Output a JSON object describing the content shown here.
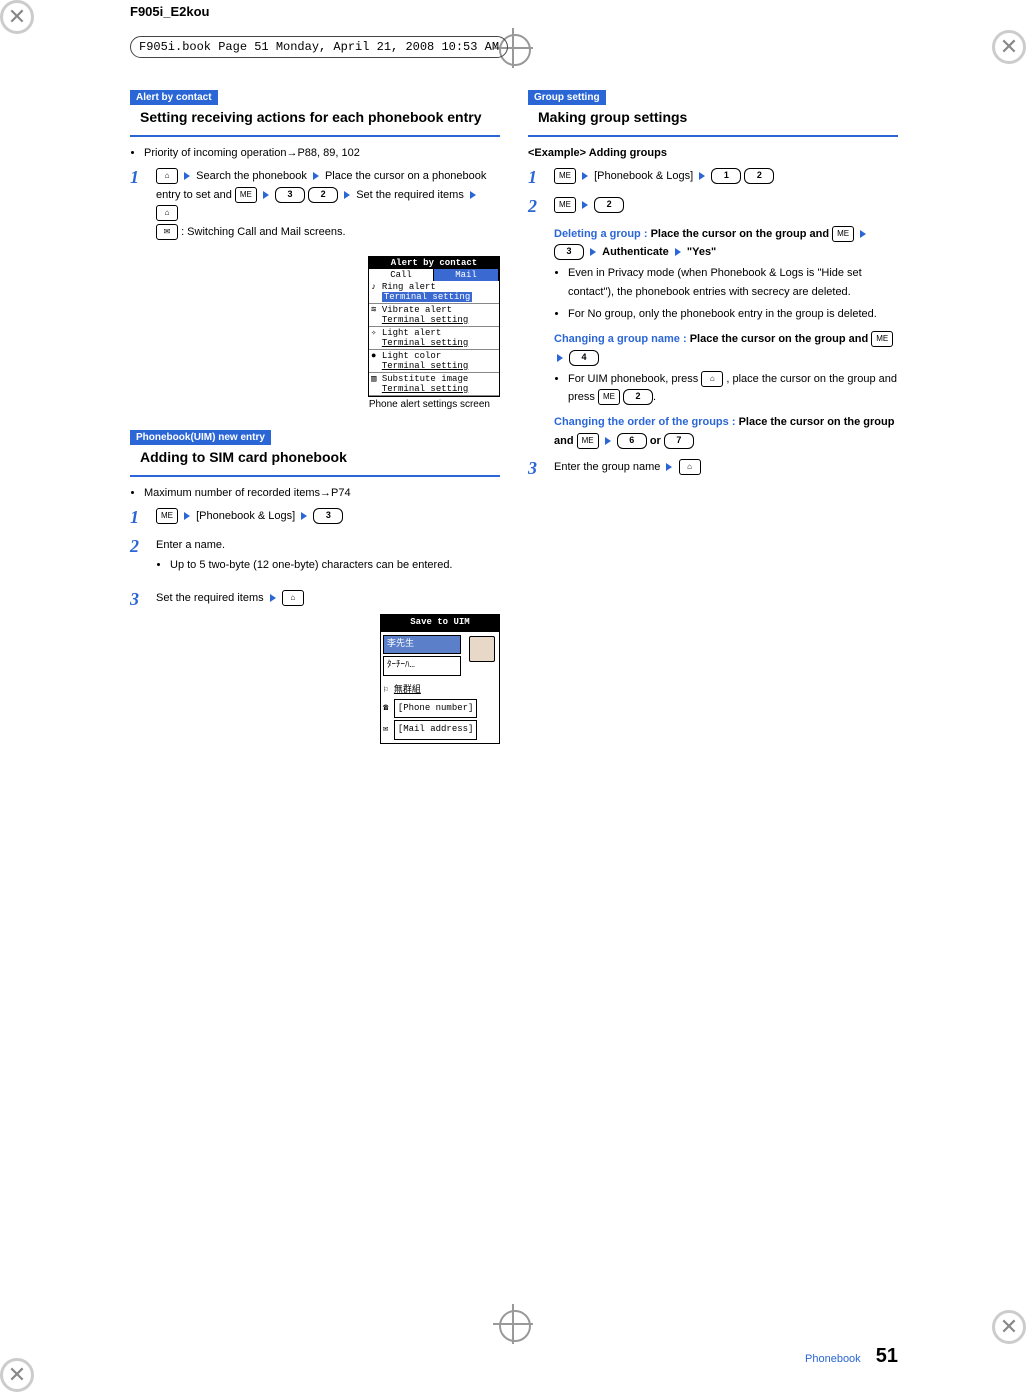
{
  "header": {
    "model": "F905i_E2kou",
    "book_line": "F905i.book  Page 51  Monday, April 21, 2008  10:53 AM"
  },
  "left": {
    "sec1": {
      "tag": "Alert by contact",
      "title": "Setting receiving actions for each phonebook entry"
    },
    "bullet1": "Priority of incoming operation→P88, 89, 102",
    "step1": {
      "pre": "Search the phonebook",
      "mid": "Place the cursor on a phonebook entry to set and",
      "tail": "Set the required items",
      "switch": ": Switching Call and Mail screens."
    },
    "key3": "3",
    "key2": "2",
    "phone_screen": {
      "title": "Alert by contact",
      "tab_call": "Call",
      "tab_mail": "Mail",
      "r1": "Ring alert",
      "v1": "Terminal setting",
      "r2": "Vibrate alert",
      "v2": "Terminal setting",
      "r3": "Light alert",
      "v3": "Terminal setting",
      "r4": "Light color",
      "v4": "Terminal setting",
      "r5": "Substitute image",
      "v5": "Terminal setting"
    },
    "caption": "Phone alert settings screen",
    "sec2": {
      "tag": "Phonebook(UIM) new entry",
      "title": "Adding to SIM card phonebook"
    },
    "bullet2": "Maximum number of recorded items→P74",
    "step_sim1": "[Phonebook & Logs]",
    "key_sim_3": "3",
    "step_sim2": "Enter a name.",
    "bullet3": "Up to 5 two-byte (12 one-byte) characters can be entered.",
    "step_sim3": "Set the required items",
    "save_uim": {
      "title": "Save to UIM",
      "name": "李先生",
      "kana": "ﾀｰﾁｰﾊ…",
      "grp": "無群組",
      "phone": "[Phone number]",
      "mail": "[Mail address]"
    }
  },
  "right": {
    "sec": {
      "tag": "Group setting",
      "title": "Making group settings"
    },
    "example": "<Example>   Adding groups",
    "step1": "[Phonebook & Logs]",
    "k1": "1",
    "k2": "2",
    "delgrp": {
      "label": "Deleting a group :",
      "body": "Place the cursor on the group and",
      "tail": "Authenticate",
      "yes": "\"Yes\"",
      "k3": "3"
    },
    "delnote1": "Even in Privacy mode (when Phonebook & Logs is \"Hide set contact\"), the phonebook entries with secrecy are deleted.",
    "delnote2": "For No group, only the phonebook entry in the group is deleted.",
    "chname": {
      "label": "Changing a group name :",
      "body": "Place the cursor on the group and",
      "k4": "4"
    },
    "chnote": "For UIM phonebook, press",
    "chnote2": ", place the cursor on the group and press",
    "k2b": "2",
    "order": {
      "label": "Changing the order of the groups :",
      "body": "Place the cursor on the group and",
      "k6": "6",
      "or": "or",
      "k7": "7"
    },
    "step3": "Enter the group name"
  },
  "footer": {
    "section": "Phonebook",
    "page": "51"
  },
  "icons": {
    "menu": "ME",
    "book": "⌂",
    "env": "✉"
  }
}
